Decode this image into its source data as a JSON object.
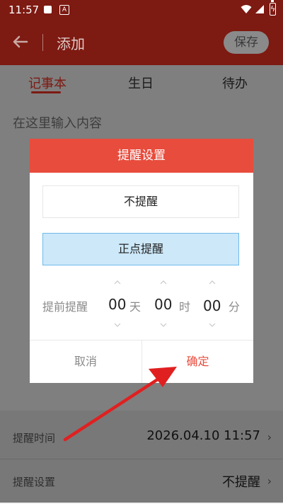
{
  "status_bar": {
    "time": "11:57"
  },
  "app_bar": {
    "title": "添加",
    "save_label": "保存"
  },
  "tabs": [
    {
      "label": "记事本",
      "active": true
    },
    {
      "label": "生日",
      "active": false
    },
    {
      "label": "待办",
      "active": false
    }
  ],
  "editor": {
    "placeholder": "在这里输入内容"
  },
  "settings_rows": [
    {
      "label": "提醒时间",
      "value": "2026.04.10 11:57"
    },
    {
      "label": "提醒设置",
      "value": "不提醒"
    }
  ],
  "dialog": {
    "title": "提醒设置",
    "options": [
      {
        "label": "不提醒",
        "selected": false
      },
      {
        "label": "正点提醒",
        "selected": true
      }
    ],
    "advance_label": "提前提醒",
    "advance": [
      {
        "value": "00",
        "unit": "天"
      },
      {
        "value": "00",
        "unit": "时"
      },
      {
        "value": "00",
        "unit": "分"
      }
    ],
    "cancel_label": "取消",
    "ok_label": "确定"
  },
  "colors": {
    "primary_dark": "#7d1a12",
    "accent": "#e84c3d",
    "selected_fill": "#cce8f9",
    "selected_border": "#6fbbe8",
    "annotation_arrow": "#e02020"
  }
}
